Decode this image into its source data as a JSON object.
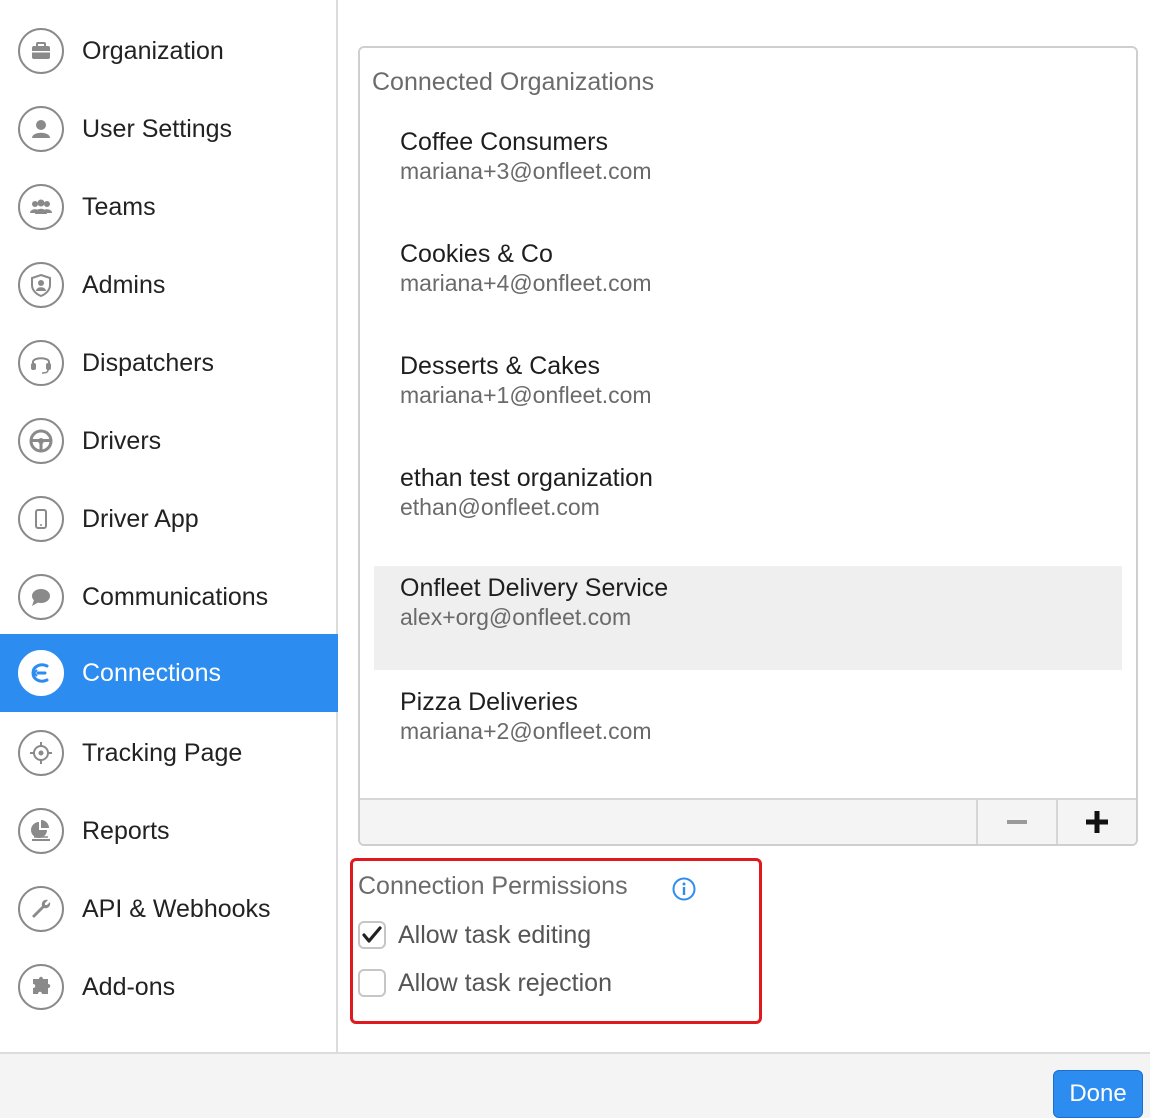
{
  "sidebar": {
    "items": [
      {
        "label": "Organization",
        "icon": "briefcase-icon",
        "active": false
      },
      {
        "label": "User Settings",
        "icon": "user-icon",
        "active": false
      },
      {
        "label": "Teams",
        "icon": "team-icon",
        "active": false
      },
      {
        "label": "Admins",
        "icon": "shield-user-icon",
        "active": false
      },
      {
        "label": "Dispatchers",
        "icon": "headset-icon",
        "active": false
      },
      {
        "label": "Drivers",
        "icon": "steering-wheel-icon",
        "active": false
      },
      {
        "label": "Driver App",
        "icon": "phone-icon",
        "active": false
      },
      {
        "label": "Communications",
        "icon": "chat-bubble-icon",
        "active": false
      },
      {
        "label": "Connections",
        "icon": "connections-icon",
        "active": true
      },
      {
        "label": "Tracking Page",
        "icon": "crosshair-icon",
        "active": false
      },
      {
        "label": "Reports",
        "icon": "report-chart-icon",
        "active": false
      },
      {
        "label": "API & Webhooks",
        "icon": "wrench-icon",
        "active": false
      },
      {
        "label": "Add-ons",
        "icon": "puzzle-icon",
        "active": false
      }
    ]
  },
  "connected_orgs": {
    "title": "Connected Organizations",
    "items": [
      {
        "name": "Coffee Consumers",
        "email": "mariana+3@onfleet.com",
        "selected": false
      },
      {
        "name": "Cookies & Co",
        "email": "mariana+4@onfleet.com",
        "selected": false
      },
      {
        "name": "Desserts & Cakes",
        "email": "mariana+1@onfleet.com",
        "selected": false
      },
      {
        "name": "ethan test organization",
        "email": "ethan@onfleet.com",
        "selected": false
      },
      {
        "name": "Onfleet Delivery Service",
        "email": "alex+org@onfleet.com",
        "selected": true
      },
      {
        "name": "Pizza Deliveries",
        "email": "mariana+2@onfleet.com",
        "selected": false
      }
    ]
  },
  "permissions": {
    "title": "Connection Permissions",
    "options": [
      {
        "label": "Allow task editing",
        "checked": true
      },
      {
        "label": "Allow task rejection",
        "checked": false
      }
    ]
  },
  "footer": {
    "done_label": "Done"
  },
  "colors": {
    "accent": "#2d8cf0",
    "highlight_border": "#e0191e",
    "info_icon": "#2d8cf0"
  }
}
